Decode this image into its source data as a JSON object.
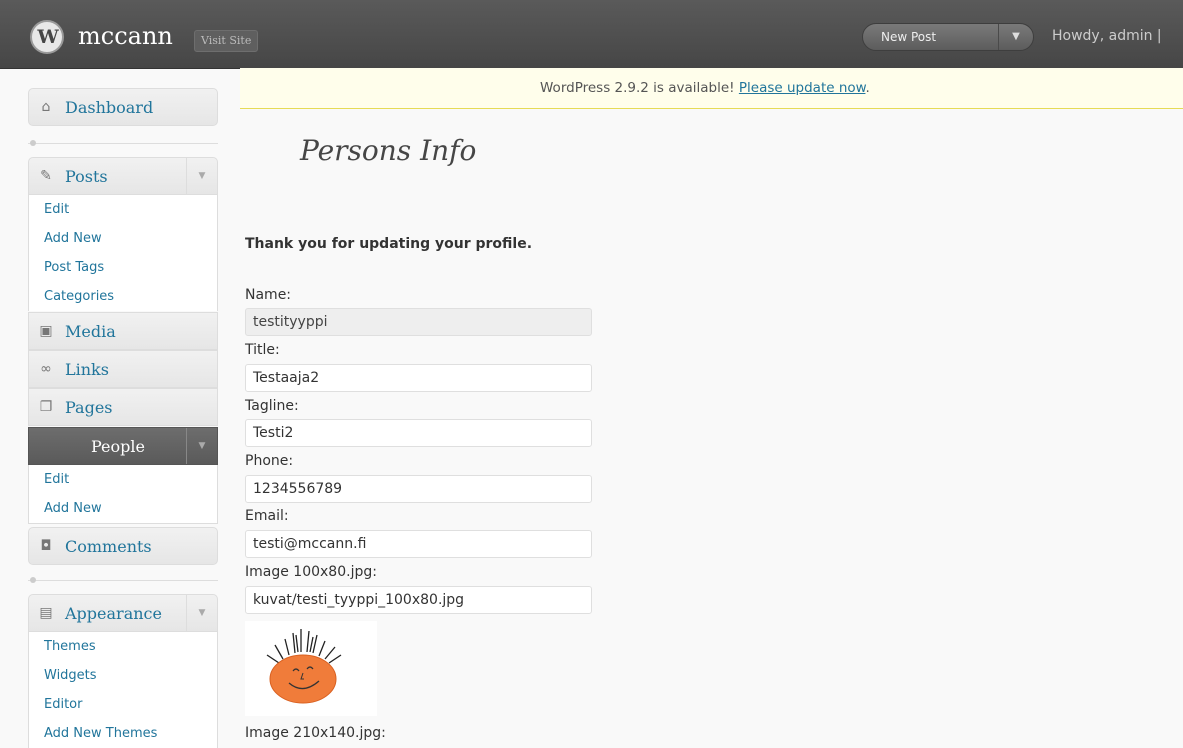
{
  "header": {
    "site_name": "mccann",
    "visit_site": "Visit Site",
    "new_post": "New Post",
    "howdy": "Howdy, admin |"
  },
  "notice": {
    "text": "WordPress 2.9.2 is available! ",
    "link": "Please update now",
    "end": "."
  },
  "sidebar": {
    "dashboard": "Dashboard",
    "posts": {
      "label": "Posts",
      "items": [
        "Edit",
        "Add New",
        "Post Tags",
        "Categories"
      ]
    },
    "media": "Media",
    "links": "Links",
    "pages": "Pages",
    "people": {
      "label": "People",
      "items": [
        "Edit",
        "Add New"
      ]
    },
    "comments": "Comments",
    "appearance": {
      "label": "Appearance",
      "items": [
        "Themes",
        "Widgets",
        "Editor",
        "Add New Themes"
      ]
    }
  },
  "main": {
    "title": "Persons Info",
    "message": "Thank you for updating your profile.",
    "fields": [
      {
        "label": "Name:",
        "value": "testityyppi"
      },
      {
        "label": "Title:",
        "value": "Testaaja2"
      },
      {
        "label": "Tagline:",
        "value": "Testi2"
      },
      {
        "label": "Phone:",
        "value": "1234556789"
      },
      {
        "label": "Email:",
        "value": "testi@mccann.fi"
      },
      {
        "label": "Image 100x80.jpg:",
        "value": "kuvat/testi_tyyppi_100x80.jpg"
      }
    ],
    "next_label": "Image 210x140.jpg:"
  }
}
